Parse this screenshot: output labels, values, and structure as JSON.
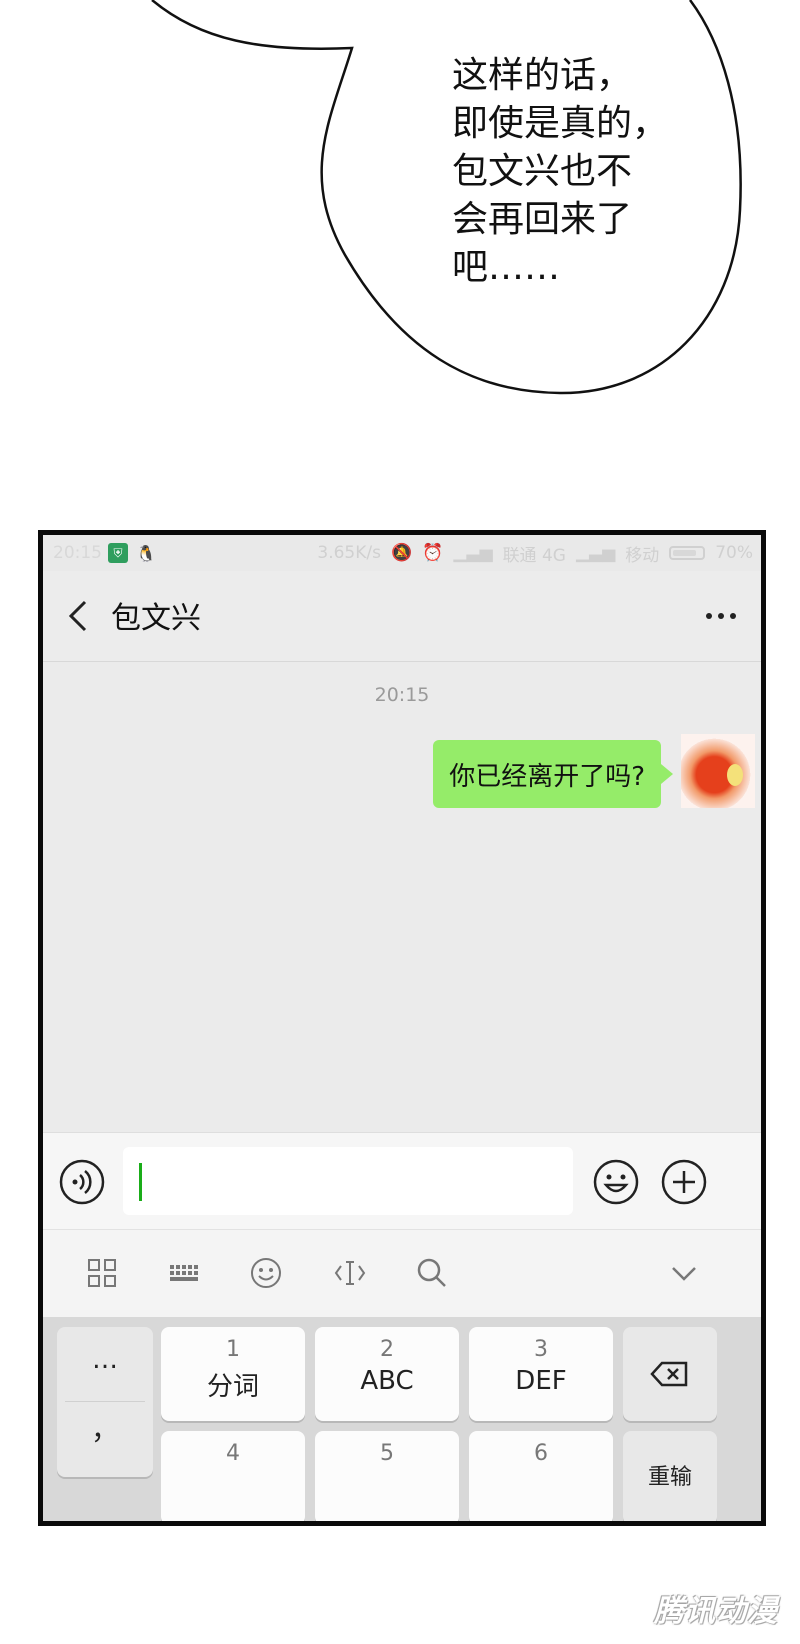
{
  "speech_bubble": {
    "lines": [
      "这样的话，",
      "即使是真的，",
      "包文兴也不",
      "会再回来了",
      "吧……"
    ]
  },
  "status_bar": {
    "time": "20:15",
    "speed": "3.65K/s",
    "carrier1": "联通 4G",
    "carrier2": "移动",
    "battery": "70%"
  },
  "chat": {
    "title": "包文兴",
    "timestamp": "20:15",
    "messages": [
      {
        "text": "你已经离开了吗?"
      }
    ]
  },
  "input": {
    "value": "",
    "placeholder": ""
  },
  "keyboard": {
    "keys": [
      {
        "num": "1",
        "label": "分词"
      },
      {
        "num": "2",
        "label": "ABC"
      },
      {
        "num": "3",
        "label": "DEF"
      },
      {
        "num": "4",
        "label": ""
      },
      {
        "num": "5",
        "label": ""
      },
      {
        "num": "6",
        "label": ""
      }
    ],
    "side_left_top": "…",
    "side_left_bottom": "，",
    "side_right_bottom": "重输"
  },
  "watermark": "腾讯动漫",
  "colors": {
    "sent_bubble": "#95ec69",
    "caret": "#1aad19"
  }
}
